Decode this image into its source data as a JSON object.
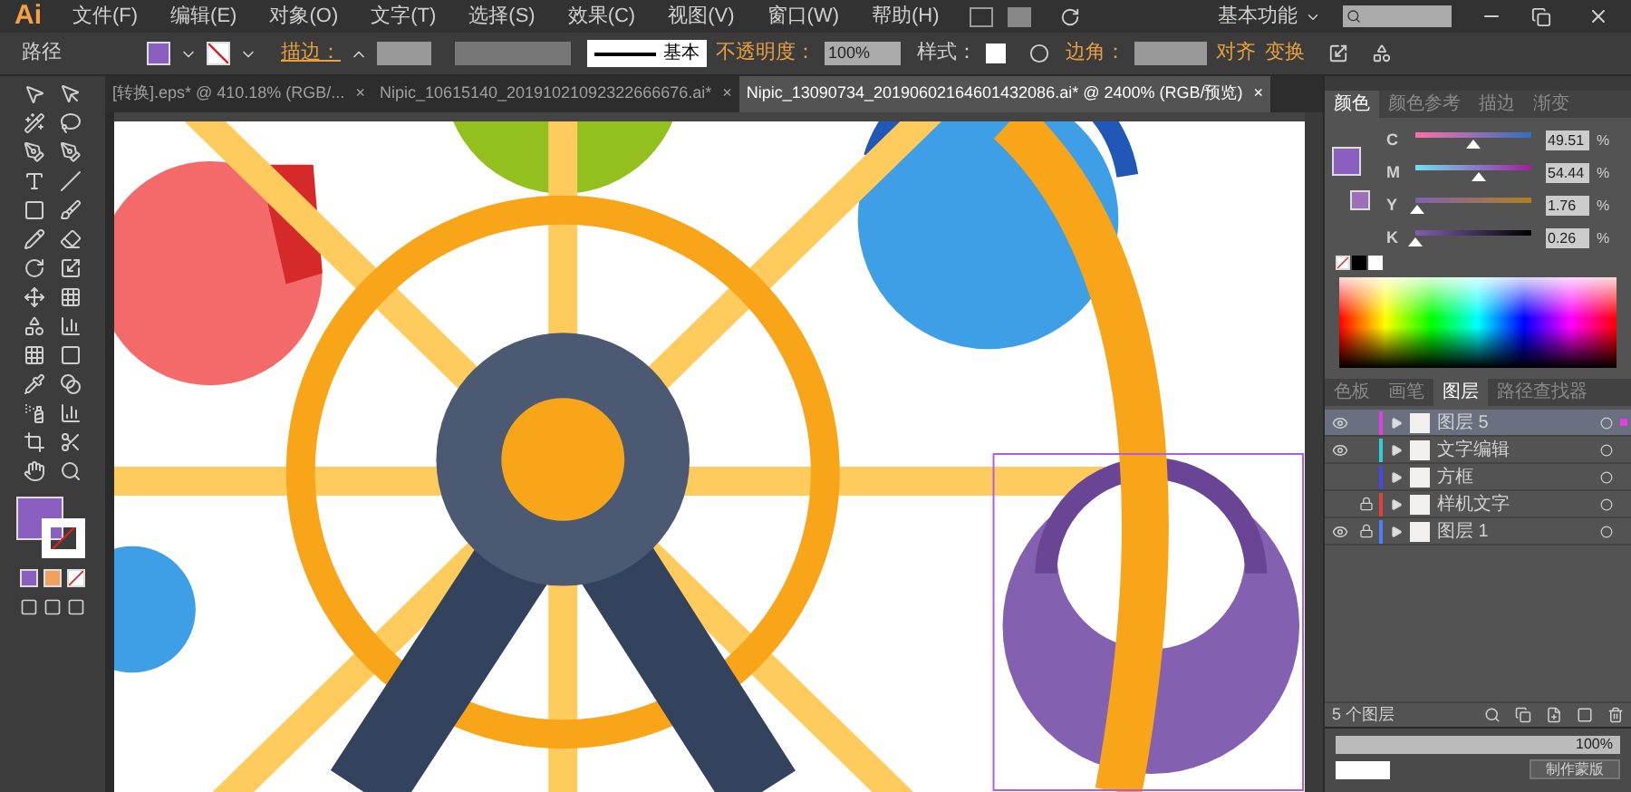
{
  "app": {
    "logo": "Ai",
    "menu": [
      "文件(F)",
      "编辑(E)",
      "对象(O)",
      "文字(T)",
      "选择(S)",
      "效果(C)",
      "视图(V)",
      "窗口(W)",
      "帮助(H)"
    ],
    "workspace": "基本功能"
  },
  "control_bar": {
    "object_type": "路径",
    "stroke_label": "描边：",
    "line_style": "基本",
    "opacity_label": "不透明度：",
    "opacity": "100%",
    "style_label": "样式：",
    "corner_label": "边角：",
    "align": "对齐",
    "transform": "变换"
  },
  "tabs": [
    {
      "label": "[转换].eps* @ 410.18% (RGB/...",
      "selected": false,
      "close": "×"
    },
    {
      "label": "Nipic_10615140_20191021092322666676.ai*",
      "selected": false,
      "close": "×"
    },
    {
      "label": "Nipic_13090734_20190602164601432086.ai* @ 2400% (RGB/预览)",
      "selected": true,
      "close": "×"
    }
  ],
  "color_panel": {
    "tabs": [
      {
        "label": "颜色",
        "selected": true
      },
      {
        "label": "颜色参考",
        "selected": false
      },
      {
        "label": "描边",
        "selected": false
      },
      {
        "label": "渐变",
        "selected": false
      }
    ],
    "sliders": [
      {
        "name": "C",
        "level": 0.4951,
        "value": "49.51"
      },
      {
        "name": "M",
        "level": 0.5444,
        "value": "54.44"
      },
      {
        "name": "Y",
        "level": 0.0176,
        "value": "1.76"
      },
      {
        "name": "K",
        "level": 0.0026,
        "value": "0.26"
      }
    ],
    "percent": "%"
  },
  "layers_panel": {
    "tabs": [
      {
        "label": "色板",
        "selected": false
      },
      {
        "label": "画笔",
        "selected": false
      },
      {
        "label": "图层",
        "selected": true
      },
      {
        "label": "路径查找器",
        "selected": false
      }
    ],
    "layers": [
      {
        "name": "图层 5",
        "visible": true,
        "locked": false,
        "color": "#e040e0",
        "selected": true
      },
      {
        "name": "文字编辑",
        "visible": true,
        "locked": false,
        "color": "#30d0d0",
        "selected": false
      },
      {
        "name": "方框",
        "visible": false,
        "locked": false,
        "color": "#4848e8",
        "selected": false
      },
      {
        "name": "样机文字",
        "visible": false,
        "locked": true,
        "color": "#e04040",
        "selected": false
      },
      {
        "name": "图层 1",
        "visible": true,
        "locked": true,
        "color": "#4a80ff",
        "selected": false
      }
    ],
    "count": "5 个图层"
  },
  "transparency_panel": {
    "opacity": "100%",
    "mask_button": "制作蒙版"
  }
}
